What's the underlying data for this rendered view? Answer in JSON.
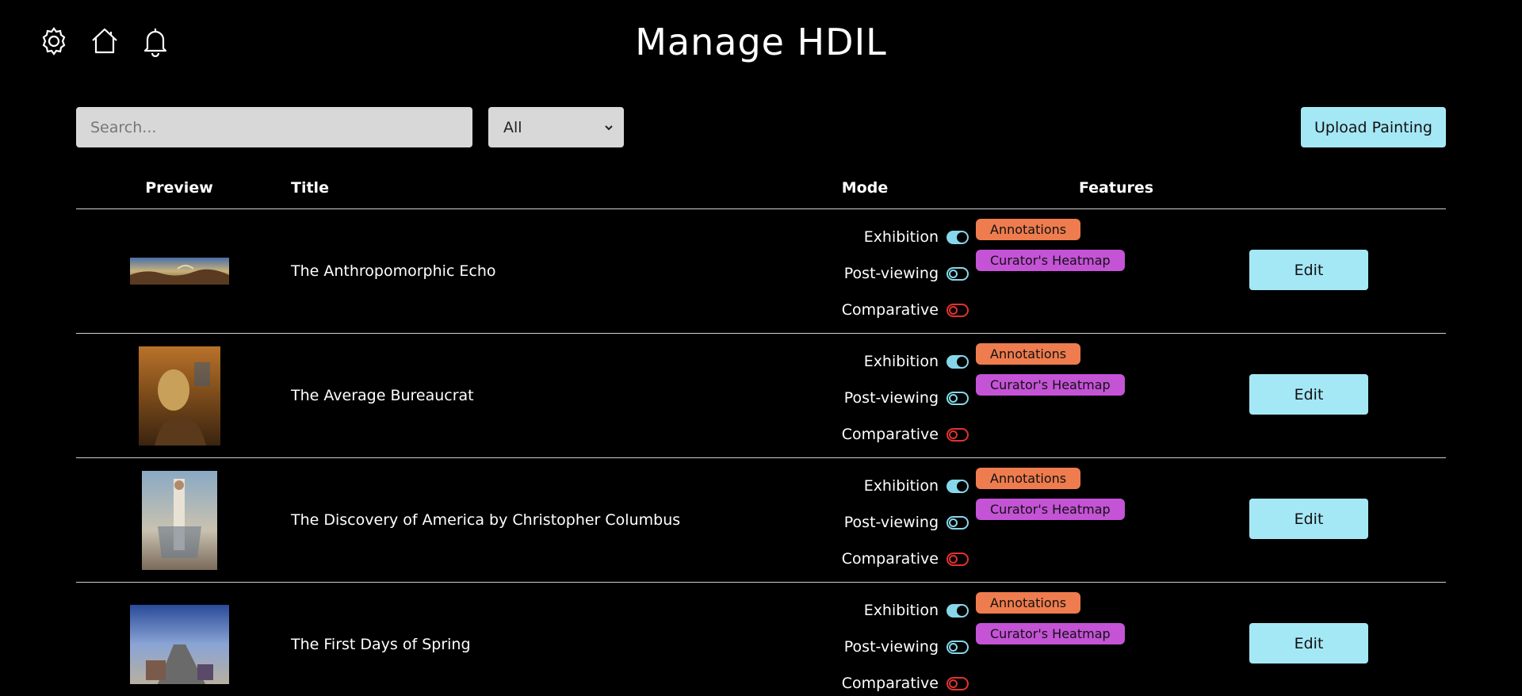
{
  "header": {
    "title": "Manage HDIL",
    "icons": [
      "gear-icon",
      "home-icon",
      "bell-icon"
    ]
  },
  "toolbar": {
    "search_placeholder": "Search...",
    "filter_value": "All",
    "upload_label": "Upload Painting"
  },
  "table": {
    "columns": [
      "Preview",
      "Title",
      "Mode",
      "Features",
      ""
    ],
    "rows": [
      {
        "title": "The Anthropomorphic Echo",
        "modes": [
          {
            "label": "Exhibition",
            "state": "on"
          },
          {
            "label": "Post-viewing",
            "state": "off"
          },
          {
            "label": "Comparative",
            "state": "off"
          }
        ],
        "features": [
          "Annotations",
          "Curator's Heatmap"
        ],
        "edit_label": "Edit"
      },
      {
        "title": "The Average Bureaucrat",
        "modes": [
          {
            "label": "Exhibition",
            "state": "on"
          },
          {
            "label": "Post-viewing",
            "state": "off"
          },
          {
            "label": "Comparative",
            "state": "off"
          }
        ],
        "features": [
          "Annotations",
          "Curator's Heatmap"
        ],
        "edit_label": "Edit"
      },
      {
        "title": "The Discovery of America by Christopher Columbus",
        "modes": [
          {
            "label": "Exhibition",
            "state": "on"
          },
          {
            "label": "Post-viewing",
            "state": "off"
          },
          {
            "label": "Comparative",
            "state": "off"
          }
        ],
        "features": [
          "Annotations",
          "Curator's Heatmap"
        ],
        "edit_label": "Edit"
      },
      {
        "title": "The First Days of Spring",
        "modes": [
          {
            "label": "Exhibition",
            "state": "on"
          },
          {
            "label": "Post-viewing",
            "state": "off"
          },
          {
            "label": "Comparative",
            "state": "off"
          }
        ],
        "features": [
          "Annotations",
          "Curator's Heatmap"
        ],
        "edit_label": "Edit"
      }
    ]
  },
  "colors": {
    "accent": "#a5e8f5",
    "toggle_on": "#86d7ea",
    "toggle_off_comparative": "#e0332f",
    "badge_annotations": "#ee7c4e",
    "badge_heatmap": "#c453d6"
  }
}
